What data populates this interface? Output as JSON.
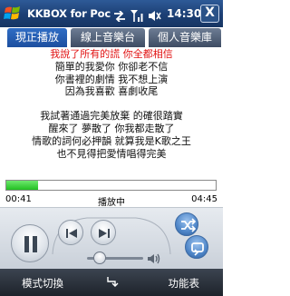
{
  "status_bar": {
    "app_title": "KKBOX for Poc",
    "clock": "14:30",
    "close_label": "X"
  },
  "tabs": [
    {
      "label": "現正播放",
      "active": true
    },
    {
      "label": "線上音樂台",
      "active": false
    },
    {
      "label": "個人音樂庫",
      "active": false
    }
  ],
  "lyrics": [
    {
      "text": "我說了所有的謊 你全都相信",
      "current": true
    },
    {
      "text": "簡單的我愛你 你卻老不信",
      "current": false
    },
    {
      "text": "你書裡的劇情 我不想上演",
      "current": false
    },
    {
      "text": "因為我喜歡 喜劇收尾",
      "current": false
    },
    {
      "text": "我試著通過完美放棄 的確很踏實",
      "current": false
    },
    {
      "text": "醒來了 夢散了 你我都走散了",
      "current": false
    },
    {
      "text": "情歌的詞何必押韻 就算我是K歌之王",
      "current": false
    },
    {
      "text": "也不見得把愛情唱得完美",
      "current": false
    }
  ],
  "player": {
    "elapsed": "00:41",
    "status": "播放中",
    "duration": "04:45",
    "progress": 0.15,
    "volume": 0.22
  },
  "softkeys": {
    "left": "模式切換",
    "right": "功能表"
  },
  "colors": {
    "status_bar": "#1c3f74",
    "tab_active": "#2f6dc5",
    "tab_inactive": "#4a586e",
    "current_lyric": "#e11212",
    "progress": "#22c022",
    "softkey_bar": "#1d232b"
  },
  "icons": {
    "start": "windows-logo-icon",
    "signal": "signal-icon",
    "sync": "sync-arrows-icon",
    "speaker": "speaker-icon",
    "pause": "pause-icon",
    "previous": "previous-track-icon",
    "next": "next-track-icon",
    "shuffle": "shuffle-icon",
    "repeat": "repeat-icon",
    "volume": "volume-icon",
    "keyboard": "keyboard-icon"
  }
}
